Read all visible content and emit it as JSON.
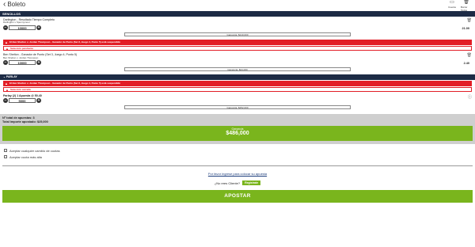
{
  "header": {
    "back_label": "Boleto",
    "icons": [
      {
        "name": "cuenta-icon",
        "label": "Cuenta"
      },
      {
        "name": "trash-icon",
        "label": "Borrar Todos"
      }
    ]
  },
  "singles": {
    "section_label": "SENCILLOS",
    "bet1": {
      "title": "Darlington - Resultado Tiempo Completo",
      "sub": "Darlington v Spennymoor",
      "odds": "21.00",
      "stake": "10000",
      "gain": "Ganancia: $210,000"
    },
    "alert1": "El Ben Shelton v. Jordan Thompson - Ganador de Punto (Set 3, Juego 4, Punto 5) está suspendido",
    "alert1_sub": "Selección pendiente",
    "bet2": {
      "title": "Ben Shelton - Ganador de Punto (Set 3, Juego 4, Punto 5)",
      "sub": "Ben Shelton v. Jordan Thompson",
      "odds": "2.40",
      "stake": "10000",
      "gain": "Ganancia: $24,000"
    }
  },
  "parlay": {
    "section_label": "PARLAY",
    "alert": "El Ben Shelton v. Jordan Thompson - Ganador de Punto (Set 3, Juego 4, Punto 5) está suspendido",
    "alert_sub": "Selección cerrada",
    "title": "Parlay (2)",
    "detail": "1 Apuesta @ 50.40",
    "stake": "5000",
    "gain": "Ganancia: $252,000"
  },
  "summary": {
    "total_bets": "Nº total de apuestas: 3",
    "total_amount": "Total importe apostado: $25,000",
    "gain_label": "Ganancia",
    "gain_amount": "$486,000"
  },
  "options": {
    "opt1": "Aceptar cualquier cambio de cuotas",
    "opt2": "Aceptar cuota más alta"
  },
  "footer": {
    "login_text": "Por favor ingrese para colocar su apuesta",
    "client_q": "¿No eres Cliente?",
    "register_label": "Registrate",
    "apostar_label": "APOSTAR"
  }
}
